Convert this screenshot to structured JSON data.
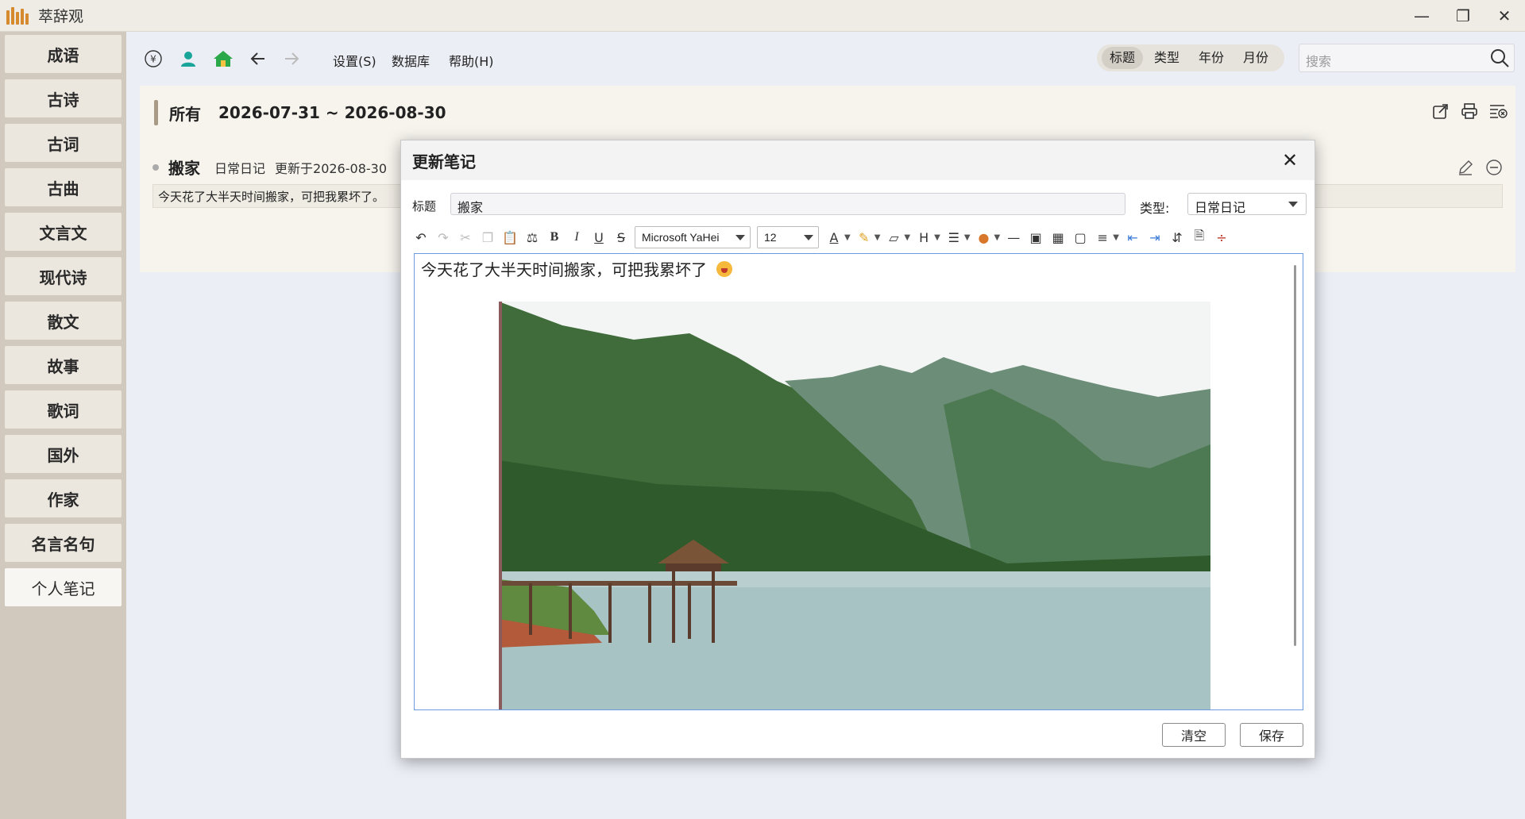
{
  "app": {
    "title": "萃辞观"
  },
  "sidebar": {
    "items": [
      {
        "label": "成语"
      },
      {
        "label": "古诗"
      },
      {
        "label": "古词"
      },
      {
        "label": "古曲"
      },
      {
        "label": "文言文"
      },
      {
        "label": "现代诗"
      },
      {
        "label": "散文"
      },
      {
        "label": "故事"
      },
      {
        "label": "歌词"
      },
      {
        "label": "国外"
      },
      {
        "label": "作家"
      },
      {
        "label": "名言名句"
      },
      {
        "label": "个人笔记"
      }
    ],
    "active": "个人笔记"
  },
  "toolbar": {
    "menus": [
      "设置(S)",
      "数据库",
      "帮助(H)"
    ],
    "segments": [
      "标题",
      "类型",
      "年份",
      "月份"
    ],
    "active_segment": "标题",
    "search_placeholder": "搜索",
    "icons": [
      "yen-icon",
      "user-icon",
      "home-icon",
      "back-arrow-icon",
      "forward-arrow-icon"
    ]
  },
  "panel": {
    "filter_all": "所有",
    "date_range": "2026-07-31 ~ 2026-08-30",
    "note": {
      "title": "搬家",
      "type": "日常日记",
      "updated": "更新于2026-08-30",
      "preview": "今天花了大半天时间搬家，可把我累坏了。"
    }
  },
  "dialog": {
    "title": "更新笔记",
    "title_label": "标题",
    "title_value": "搬家",
    "type_label": "类型:",
    "type_value": "日常日记",
    "font_family": "Microsoft YaHei",
    "font_size": "12",
    "content_text": "今天花了大半天时间搬家，可把我累坏了",
    "clear_button": "清空",
    "save_button": "保存"
  },
  "colors": {
    "sidebar_bg": "#d1c9bd",
    "accent_brown": "#a89a84",
    "user_icon": "#1aa59a",
    "home_icon": "#2aa84a",
    "editor_border": "#6a9be0"
  }
}
